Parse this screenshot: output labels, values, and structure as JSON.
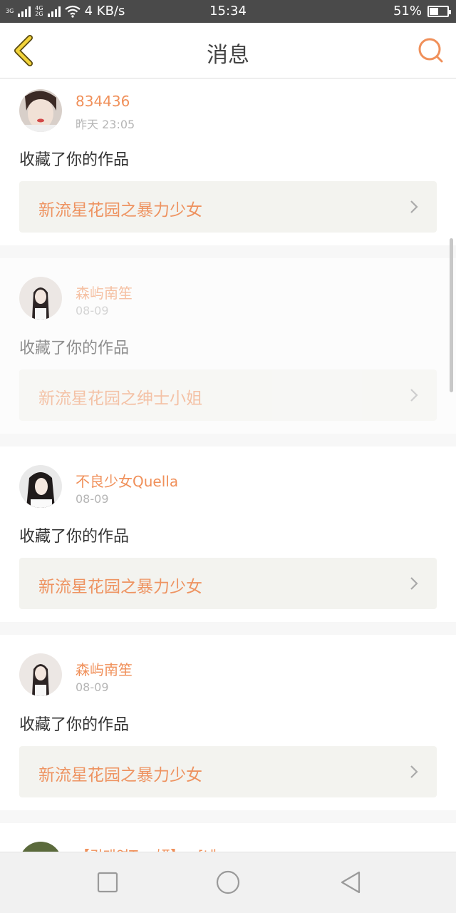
{
  "status_bar": {
    "net_top": "3G",
    "net_mid_top": "4G",
    "net_mid_bottom": "2G",
    "speed": "4 KB/s",
    "time": "15:34",
    "battery": "51%",
    "battery_level": 0.51
  },
  "header": {
    "title": "消息",
    "back_icon": "chevron-left-icon",
    "search_icon": "search-icon",
    "accent_color": "#f0905a"
  },
  "notifications": [
    {
      "user": "834436",
      "time": "昨天 23:05",
      "action": "收藏了你的作品",
      "work_title": "新流星花园之暴力少女"
    },
    {
      "user": "森屿南笙",
      "time": "08-09",
      "action": "收藏了你的作品",
      "work_title": "新流星花园之绅士小姐"
    },
    {
      "user": "不良少女Quella",
      "time": "08-09",
      "action": "收藏了你的作品",
      "work_title": "新流星花园之暴力少女"
    },
    {
      "user": "森屿南笙",
      "time": "08-09",
      "action": "收藏了你的作品",
      "work_title": "新流星花园之暴力少女"
    },
    {
      "user": "【김태연T····妍】 · [네",
      "time": "",
      "action": "",
      "work_title": ""
    }
  ],
  "nav": {
    "recent_icon": "square-icon",
    "home_icon": "circle-icon",
    "back_icon": "triangle-back-icon"
  }
}
